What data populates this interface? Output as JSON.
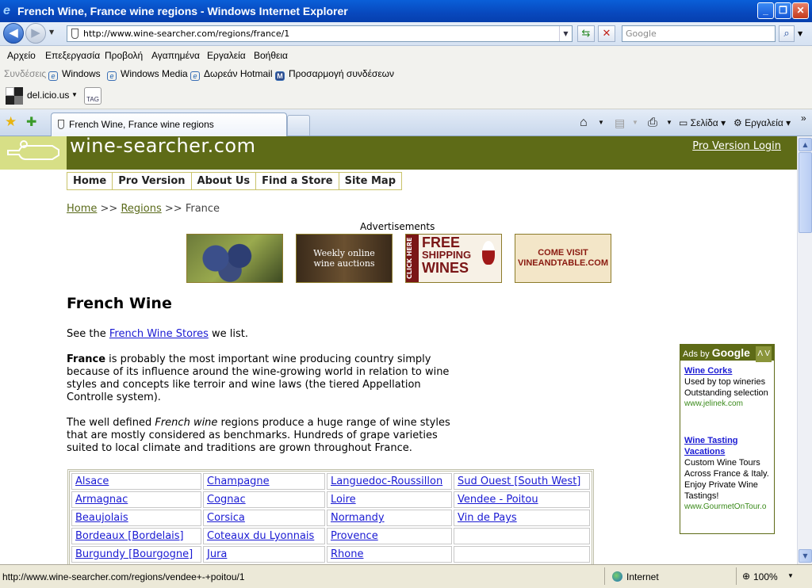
{
  "window": {
    "title": "French Wine, France wine regions - Windows Internet Explorer"
  },
  "address": {
    "url": "http://www.wine-searcher.com/regions/france/1",
    "search_placeholder": "Google"
  },
  "menu": [
    "Αρχείο",
    "Επεξεργασία",
    "Προβολή",
    "Αγαπημένα",
    "Εργαλεία",
    "Βοήθεια"
  ],
  "links": {
    "label": "Συνδέσεις",
    "items": [
      "Windows",
      "Windows Media",
      "Δωρεάν Hotmail",
      "Προσαρμογή συνδέσεων"
    ]
  },
  "delicious": {
    "label": "del.icio.us",
    "tag": "TAG"
  },
  "tab": {
    "title": "French Wine, France wine regions"
  },
  "commands": {
    "page": "Σελίδα",
    "tools": "Εργαλεία"
  },
  "page": {
    "site_name": "wine-searcher.com",
    "pro_login": "Pro Version Login",
    "nav": [
      "Home",
      "Pro Version",
      "About Us",
      "Find a Store",
      "Site Map"
    ],
    "breadcrumb": {
      "home": "Home",
      "sep": ">>",
      "regions": "Regions",
      "current": "France"
    },
    "ads_label": "Advertisements",
    "ads": [
      {
        "text": ""
      },
      {
        "line1": "Weekly online",
        "line2": "wine auctions"
      },
      {
        "side": "CLICK HERE",
        "line1": "FREE",
        "line2": "SHIPPING",
        "line3": "WINES"
      },
      {
        "line1": "COME VISIT",
        "line2": "VINEANDTABLE.COM"
      }
    ],
    "heading": "French Wine",
    "intro": {
      "pre": "See the ",
      "link": "French Wine Stores",
      "post": " we list."
    },
    "para1": {
      "bold": "France",
      "text": " is probably the most important wine producing country simply because of its influence around the wine-growing world in relation to wine styles and concepts like terroir and wine laws (the tiered Appellation Controlle system)."
    },
    "para2": {
      "pre": "The well defined ",
      "em": "French wine",
      "post": " regions produce a huge range of wine styles that are mostly considered as benchmarks. Hundreds of grape varieties suited to local climate and traditions are grown throughout France."
    },
    "regions": [
      [
        "Alsace",
        "Champagne",
        "Languedoc-Roussillon",
        "Sud Ouest [South West]"
      ],
      [
        "Armagnac",
        "Cognac",
        "Loire",
        "Vendee - Poitou"
      ],
      [
        "Beaujolais",
        "Corsica",
        "Normandy",
        "Vin de Pays"
      ],
      [
        "Bordeaux [Bordelais]",
        "Coteaux du Lyonnais",
        "Provence",
        ""
      ],
      [
        "Burgundy [Bourgogne]",
        "Jura",
        "Rhone",
        ""
      ]
    ],
    "google_ads": {
      "header_pre": "Ads by ",
      "header_brand": "Google",
      "items": [
        {
          "title": "Wine Corks",
          "lines": [
            "Used by top wineries",
            "Outstanding selection"
          ],
          "url": "www.jelinek.com"
        },
        {
          "title": "Wine Tasting Vacations",
          "lines": [
            "Custom Wine Tours",
            "Across France & Italy.",
            "Enjoy Private Wine",
            "Tastings!"
          ],
          "url": "www.GourmetOnTour.o"
        }
      ]
    }
  },
  "status": {
    "url": "http://www.wine-searcher.com/regions/vendee+-+poitou/1",
    "zone": "Internet",
    "zoom": "100%"
  },
  "colors": {
    "header": "#5e6b17",
    "logo_bg": "#d7df86",
    "link": "#1a1ad3"
  }
}
